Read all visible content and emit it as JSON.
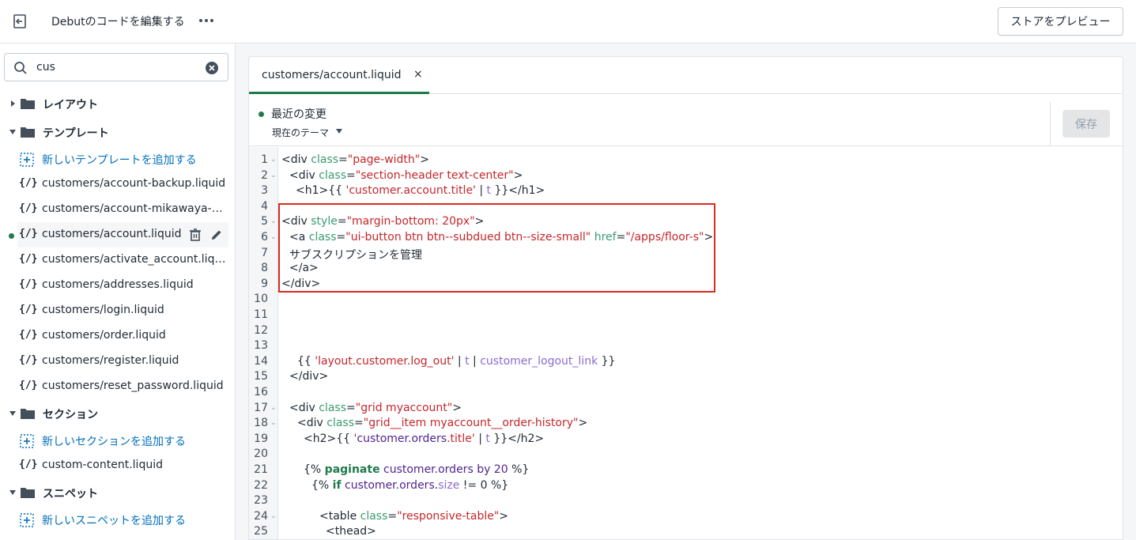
{
  "header": {
    "title": "Debutのコードを編集する",
    "preview_label": "ストアをプレビュー",
    "exit_icon": "exit-icon",
    "more_icon": "more-horizontal-icon"
  },
  "search": {
    "value": "cus",
    "icon": "search-icon",
    "clear_icon": "clear-circle-icon"
  },
  "sidebar": {
    "layout_folder": "レイアウト",
    "template_folder": "テンプレート",
    "add_template": "新しいテンプレートを追加する",
    "template_files": [
      "customers/account-backup.liquid",
      "customers/account-mikawaya-backup.liquid",
      "customers/account.liquid",
      "customers/activate_account.liquid",
      "customers/addresses.liquid",
      "customers/login.liquid",
      "customers/order.liquid",
      "customers/register.liquid",
      "customers/reset_password.liquid"
    ],
    "section_folder": "セクション",
    "add_section": "新しいセクションを追加する",
    "section_files": [
      "custom-content.liquid"
    ],
    "snippet_folder": "スニペット",
    "add_snippet": "新しいスニペットを追加する",
    "file_icon_text": "{/}"
  },
  "editor": {
    "tab_label": "customers/account.liquid",
    "tab_close": "×",
    "recent_changes": "最近の変更",
    "theme_selector": "現在のテーマ",
    "save_label": "保存",
    "colors": {
      "accent_green": "#1f7a4d",
      "highlight_red": "#d92c20",
      "link_blue": "#006fbb"
    }
  },
  "code_lines": {
    "1": "<div class=\"page-width\">",
    "2": "<div class=\"section-header text-center\">",
    "3": "<h1>{{ 'customer.account.title' | t }}</h1>",
    "5": "<div style=\"margin-bottom: 20px\">",
    "6": "<a class=\"ui-button btn btn--subdued btn--size-small\" href=\"/apps/floor-s\">",
    "7": "サブスクリプションを管理",
    "8": "</a>",
    "9": "</div>",
    "14": "{{ 'layout.customer.log_out' | t | customer_logout_link }}",
    "15": "</div>",
    "17": "<div class=\"grid myaccount\">",
    "18": "<div class=\"grid__item myaccount__order-history\">",
    "19": "<h2>{{ 'customer.orders.title' | t }}</h2>",
    "21": "{% paginate customer.orders by 20 %}",
    "22": "{% if customer.orders.size != 0 %}",
    "24": "<table class=\"responsive-table\">",
    "25": "<thead>"
  },
  "line_numbers": [
    "1",
    "2",
    "3",
    "4",
    "5",
    "6",
    "7",
    "8",
    "9",
    "10",
    "11",
    "12",
    "13",
    "14",
    "15",
    "16",
    "17",
    "18",
    "19",
    "20",
    "21",
    "22",
    "23",
    "24",
    "25"
  ]
}
